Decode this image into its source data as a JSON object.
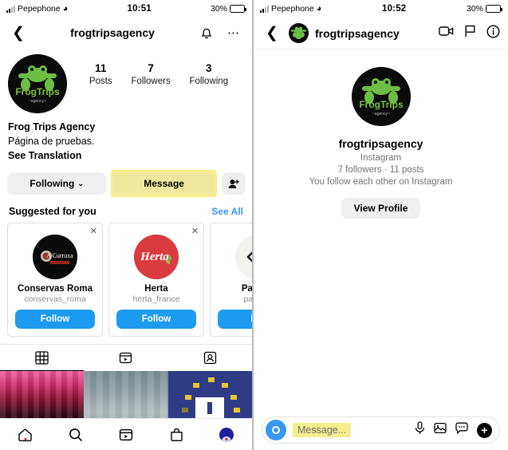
{
  "left_screen": {
    "status_bar": {
      "carrier": "Pepephone",
      "time": "10:51",
      "battery_pct": "30%"
    },
    "nav": {
      "back_icon": "chevron-left-icon",
      "title": "frogtripsagency",
      "bell_icon": "bell-icon",
      "more_icon": "ellipsis-icon"
    },
    "profile": {
      "avatar_alt": "FrogTrips agency logo",
      "stats": [
        {
          "value": "11",
          "label": "Posts"
        },
        {
          "value": "7",
          "label": "Followers"
        },
        {
          "value": "3",
          "label": "Following"
        }
      ],
      "display_name": "Frog Trips Agency",
      "bio": "Página de pruebas.",
      "translation_link": "See Translation"
    },
    "actions": {
      "following_label": "Following",
      "following_chevron": "⌄",
      "message_label": "Message",
      "add_user_icon": "add-person-icon"
    },
    "suggested": {
      "title": "Suggested for you",
      "see_all": "See All",
      "cards": [
        {
          "name": "Conservas Roma",
          "username": "conservas_roma",
          "follow_label": "Follow",
          "avatar_bg": "#0b0b0b"
        },
        {
          "name": "Herta",
          "username": "herta_france",
          "follow_label": "Follow",
          "avatar_bg": "#da3b3f"
        },
        {
          "name": "Party D",
          "username": "partyde",
          "follow_label": "Fol",
          "avatar_bg": "#f2f2ef"
        }
      ]
    },
    "tabs": [
      {
        "icon": "grid-icon",
        "active": true
      },
      {
        "icon": "reels-icon",
        "active": false
      },
      {
        "icon": "tagged-icon",
        "active": false
      }
    ],
    "bottom_nav": [
      {
        "icon": "home-icon",
        "badge": true
      },
      {
        "icon": "search-icon",
        "badge": false
      },
      {
        "icon": "reels-icon",
        "badge": false
      },
      {
        "icon": "shop-icon",
        "badge": false
      },
      {
        "icon": "profile-avatar-icon",
        "badge": true
      }
    ]
  },
  "right_screen": {
    "status_bar": {
      "carrier": "Pepephone",
      "time": "10:52",
      "battery_pct": "30%"
    },
    "nav": {
      "back_icon": "chevron-left-icon",
      "title": "frogtripsagency",
      "video_icon": "video-camera-icon",
      "flag_icon": "flag-icon",
      "info_icon": "info-circle-icon"
    },
    "thread_info": {
      "username": "frogtripsagency",
      "platform": "Instagram",
      "stats": "7 followers · 11 posts",
      "relationship": "You follow each other on Instagram",
      "view_profile_label": "View Profile"
    },
    "composer": {
      "camera_icon": "camera-icon",
      "placeholder": "Message...",
      "mic_icon": "microphone-icon",
      "gallery_icon": "image-icon",
      "sticker_icon": "sticker-icon",
      "plus_icon": "plus-icon"
    }
  },
  "colors": {
    "accent_blue": "#1d9bf0",
    "link_blue": "#3897f0",
    "highlight_yellow": "#f5ee8d",
    "button_grey": "#efefef",
    "muted_text": "#737373"
  }
}
